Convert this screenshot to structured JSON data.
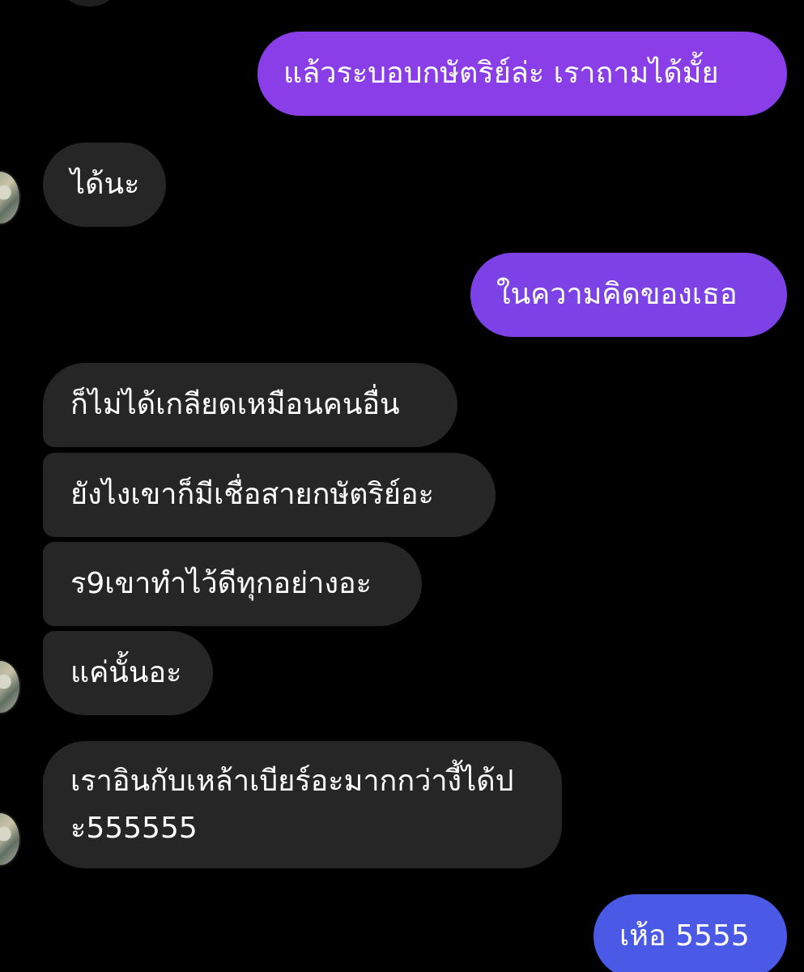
{
  "colors": {
    "background": "#000000",
    "incoming_bubble": "#262626",
    "outgoing_purple": "#7b3fe4",
    "outgoing_blue": "#4b5ae6",
    "text": "#ffffff"
  },
  "messages": [
    {
      "id": "m1",
      "direction": "outgoing",
      "text": "แล้วระบอบกษัตริย์ล่ะ เราถามได้มั้ย"
    },
    {
      "id": "m2",
      "direction": "incoming",
      "text": "ได้นะ"
    },
    {
      "id": "m3",
      "direction": "outgoing",
      "text": "ในความคิดของเธอ"
    },
    {
      "id": "m4",
      "direction": "incoming",
      "text": "ก็ไม่ได้เกลียดเหมือนคนอื่น"
    },
    {
      "id": "m5",
      "direction": "incoming",
      "text": "ยังไงเขาก็มีเชื่อสายกษัตริย์อะ"
    },
    {
      "id": "m6",
      "direction": "incoming",
      "text": "ร9เขาทำไว้ดีทุกอย่างอะ"
    },
    {
      "id": "m7",
      "direction": "incoming",
      "text": "แค่นั้นอะ"
    },
    {
      "id": "m8",
      "direction": "incoming",
      "text": "เราอินกับเหล้าเบียร์อะมากกว่างี้ได้ปะ555555"
    },
    {
      "id": "m9",
      "direction": "outgoing",
      "text": "เห้อ 5555"
    }
  ]
}
